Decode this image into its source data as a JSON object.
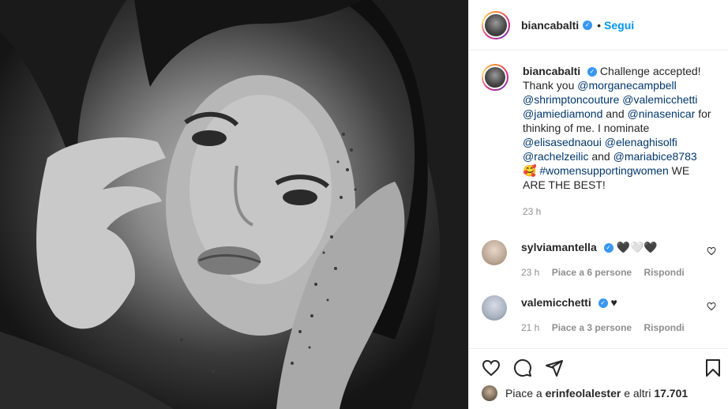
{
  "header": {
    "username": "biancabalti",
    "separator": "•",
    "follow_label": "Segui"
  },
  "caption": {
    "username": "biancabalti",
    "text_1": "Challenge accepted! Thank you",
    "m1": "@morganecampbell",
    "m2": "@shrimptoncouture",
    "m3": "@valemicchetti",
    "m4": "@jamiediamond",
    "and_1": "and",
    "m5": "@ninasenicar",
    "text_2": "for thinking of me. I nominate",
    "m6": "@elisasednaoui",
    "m7": "@elenaghisolfi",
    "m8": "@rachelzeilic",
    "and_2": "and",
    "m9": "@mariabice8783",
    "emoji": "🥰",
    "hashtag": "#womensupportingwomen",
    "text_3": "WE ARE THE BEST!",
    "time": "23 h"
  },
  "comments": [
    {
      "username": "sylviamantella",
      "text": "🖤🤍🖤",
      "time": "23 h",
      "likes": "Piace a 6 persone",
      "reply": "Rispondi"
    },
    {
      "username": "valemicchetti",
      "text": "♥",
      "time": "21 h",
      "likes": "Piace a 3 persone",
      "reply": "Rispondi"
    }
  ],
  "likes_line": {
    "prefix": "Piace a",
    "user": "erinfeolalester",
    "suffix": "e altri",
    "count": "17.701"
  },
  "colors": {
    "link": "#0095f6",
    "mention": "#00376b",
    "muted": "#8e8e8e",
    "verified": "#3897f0"
  },
  "icons": [
    "heart-icon",
    "comment-icon",
    "share-icon",
    "bookmark-icon",
    "verified-icon"
  ]
}
